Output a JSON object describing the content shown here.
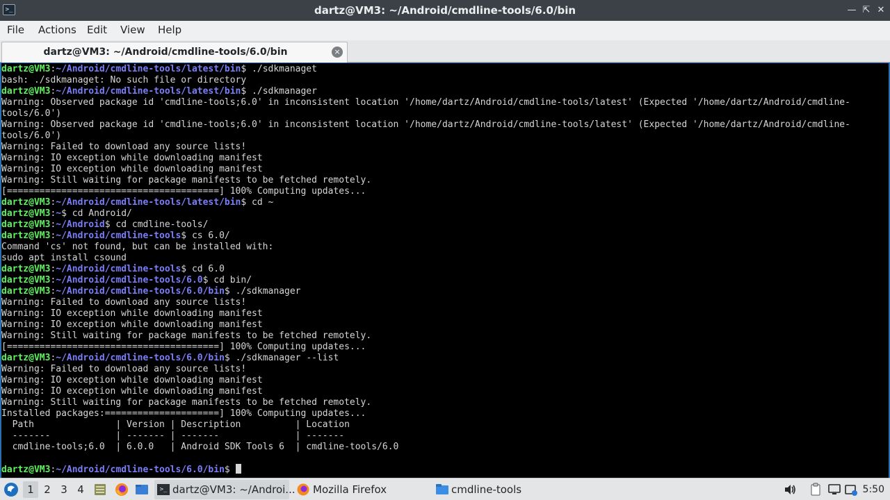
{
  "window": {
    "title": "dartz@VM3: ~/Android/cmdline-tools/6.0/bin",
    "buttons": [
      "minimize",
      "maximize",
      "close"
    ]
  },
  "menu": [
    "File",
    "Actions",
    "Edit",
    "View",
    "Help"
  ],
  "tab": {
    "label": "dartz@VM3: ~/Android/cmdline-tools/6.0/bin",
    "close_symbol": "×"
  },
  "terminal": {
    "colors": {
      "user": "#5ff35f",
      "path": "#7b7ef9",
      "text": "#d6d6d6",
      "background": "#000000"
    },
    "lines": [
      {
        "user": "dartz@VM3",
        "path": "~/Android/cmdline-tools/latest/bin",
        "cmd": " ./sdkmanaget"
      },
      {
        "text": "bash: ./sdkmanaget: No such file or directory"
      },
      {
        "user": "dartz@VM3",
        "path": "~/Android/cmdline-tools/latest/bin",
        "cmd": " ./sdkmanager"
      },
      {
        "text": "Warning: Observed package id 'cmdline-tools;6.0' in inconsistent location '/home/dartz/Android/cmdline-tools/latest' (Expected '/home/dartz/Android/cmdline-"
      },
      {
        "text": "tools/6.0')"
      },
      {
        "text": "Warning: Observed package id 'cmdline-tools;6.0' in inconsistent location '/home/dartz/Android/cmdline-tools/latest' (Expected '/home/dartz/Android/cmdline-"
      },
      {
        "text": "tools/6.0')"
      },
      {
        "text": "Warning: Failed to download any source lists!"
      },
      {
        "text": "Warning: IO exception while downloading manifest"
      },
      {
        "text": "Warning: IO exception while downloading manifest"
      },
      {
        "text": "Warning: Still waiting for package manifests to be fetched remotely."
      },
      {
        "text": "[=======================================] 100% Computing updates..."
      },
      {
        "user": "dartz@VM3",
        "path": "~/Android/cmdline-tools/latest/bin",
        "cmd": " cd ~"
      },
      {
        "user": "dartz@VM3",
        "path": "~",
        "cmd": " cd Android/"
      },
      {
        "user": "dartz@VM3",
        "path": "~/Android",
        "cmd": " cd cmdline-tools/"
      },
      {
        "user": "dartz@VM3",
        "path": "~/Android/cmdline-tools",
        "cmd": " cs 6.0/"
      },
      {
        "text": "Command 'cs' not found, but can be installed with:"
      },
      {
        "text": "sudo apt install csound"
      },
      {
        "user": "dartz@VM3",
        "path": "~/Android/cmdline-tools",
        "cmd": " cd 6.0"
      },
      {
        "user": "dartz@VM3",
        "path": "~/Android/cmdline-tools/6.0",
        "cmd": " cd bin/"
      },
      {
        "user": "dartz@VM3",
        "path": "~/Android/cmdline-tools/6.0/bin",
        "cmd": " ./sdkmanager"
      },
      {
        "text": "Warning: Failed to download any source lists!"
      },
      {
        "text": "Warning: IO exception while downloading manifest"
      },
      {
        "text": "Warning: IO exception while downloading manifest"
      },
      {
        "text": "Warning: Still waiting for package manifests to be fetched remotely."
      },
      {
        "text": "[=======================================] 100% Computing updates..."
      },
      {
        "user": "dartz@VM3",
        "path": "~/Android/cmdline-tools/6.0/bin",
        "cmd": " ./sdkmanager --list"
      },
      {
        "text": "Warning: Failed to download any source lists!"
      },
      {
        "text": "Warning: IO exception while downloading manifest"
      },
      {
        "text": "Warning: IO exception while downloading manifest"
      },
      {
        "text": "Warning: Still waiting for package manifests to be fetched remotely."
      },
      {
        "text": "Installed packages:=====================] 100% Computing updates..."
      },
      {
        "text": "  Path               | Version | Description          | Location"
      },
      {
        "text": "  -------            | ------- | -------              | -------"
      },
      {
        "text": "  cmdline-tools;6.0  | 6.0.0   | Android SDK Tools 6  | cmdline-tools/6.0"
      },
      {
        "text": ""
      },
      {
        "user": "dartz@VM3",
        "path": "~/Android/cmdline-tools/6.0/bin",
        "cmd": " ",
        "cursor": true
      }
    ]
  },
  "taskbar": {
    "workspaces": [
      "1",
      "2",
      "3",
      "4"
    ],
    "active_workspace": "1",
    "tasks": [
      {
        "label": "dartz@VM3: ~/Androi...",
        "icon": "terminal-icon",
        "active": true
      },
      {
        "label": "Mozilla Firefox",
        "icon": "firefox-icon",
        "active": false
      },
      {
        "label": "cmdline-tools",
        "icon": "folder-icon",
        "active": false
      }
    ],
    "clock": "5:50"
  }
}
